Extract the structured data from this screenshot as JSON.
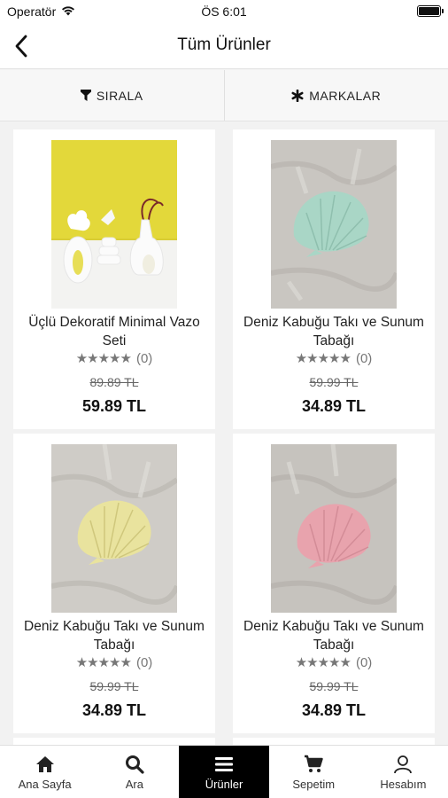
{
  "status": {
    "carrier": "Operatör",
    "time": "ÖS 6:01"
  },
  "header": {
    "title": "Tüm Ürünler"
  },
  "filters": {
    "sort_label": "SIRALA",
    "brands_label": "MARKALAR"
  },
  "products": [
    {
      "name": "Üçlü Dekoratif Minimal Vazo Seti",
      "stars": "★★★★★",
      "rating_count": "(0)",
      "old_price": "89.89 TL",
      "price": "59.89 TL",
      "image": "vase-set"
    },
    {
      "name": "Deniz Kabuğu Takı ve Sunum Tabağı",
      "stars": "★★★★★",
      "rating_count": "(0)",
      "old_price": "59.99 TL",
      "price": "34.89 TL",
      "image": "shell-mint"
    },
    {
      "name": "Deniz Kabuğu Takı ve Sunum Tabağı",
      "stars": "★★★★★",
      "rating_count": "(0)",
      "old_price": "59.99 TL",
      "price": "34.89 TL",
      "image": "shell-yellow"
    },
    {
      "name": "Deniz Kabuğu Takı ve Sunum Tabağı",
      "stars": "★★★★★",
      "rating_count": "(0)",
      "old_price": "59.99 TL",
      "price": "34.89 TL",
      "image": "shell-pink"
    }
  ],
  "tabs": [
    {
      "label": "Ana Sayfa",
      "icon": "home-icon"
    },
    {
      "label": "Ara",
      "icon": "search-icon"
    },
    {
      "label": "Ürünler",
      "icon": "menu-icon",
      "active": true
    },
    {
      "label": "Sepetim",
      "icon": "cart-icon"
    },
    {
      "label": "Hesabım",
      "icon": "user-icon"
    }
  ],
  "colors": {
    "active_tab_bg": "#000000",
    "shell_mint": "#a9d6c6",
    "shell_yellow": "#e9e39e",
    "shell_pink": "#e8a3ad",
    "vase_bg": "#e3d83a"
  }
}
